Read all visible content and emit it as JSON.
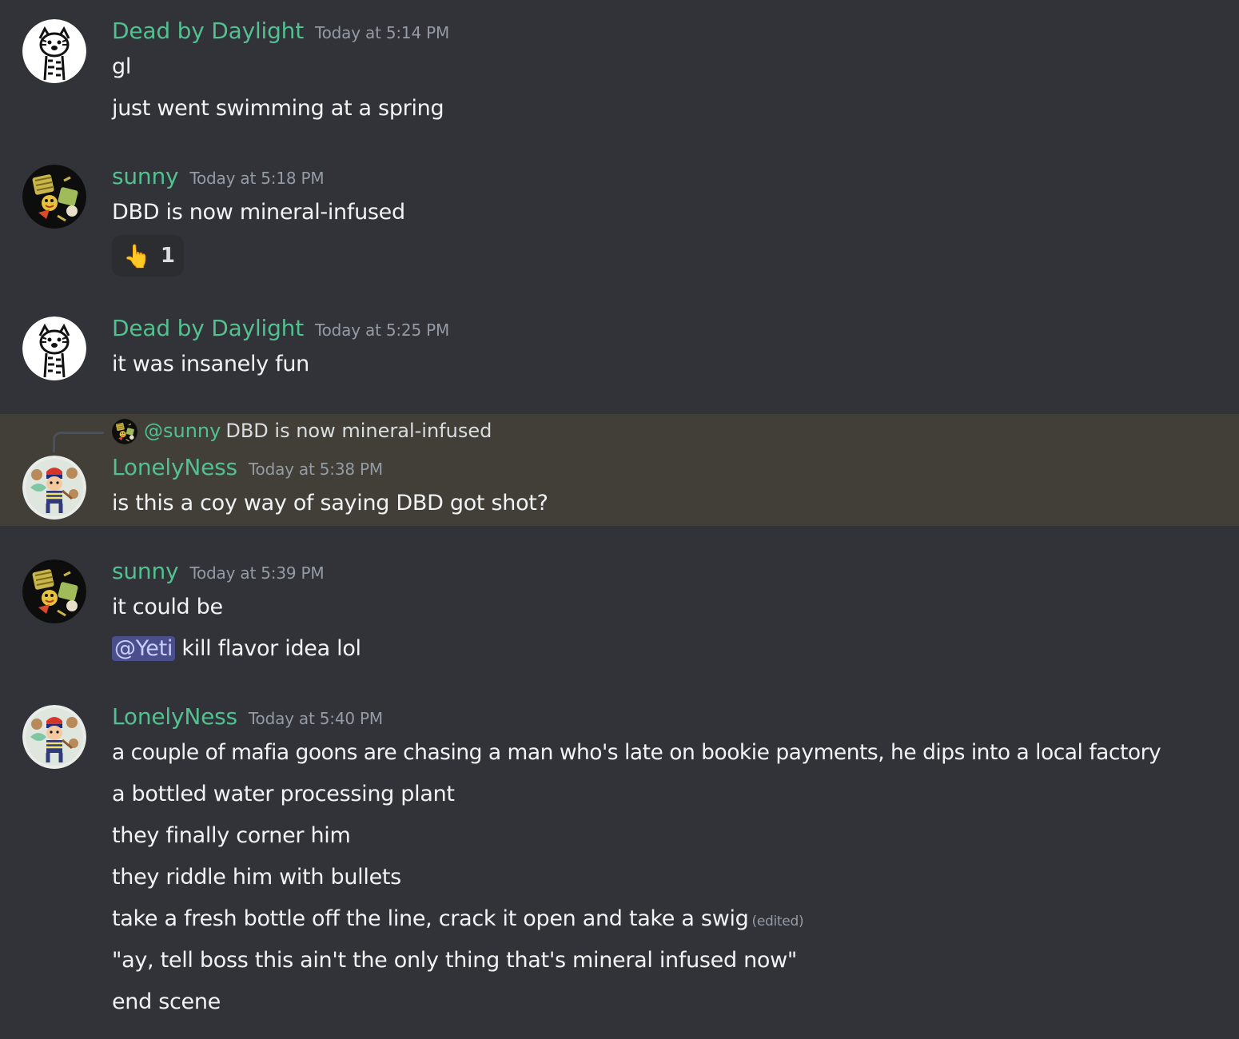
{
  "colors": {
    "background": "#313338",
    "username": "#52c08f",
    "timestamp": "#949ba4",
    "text": "#f2f3f5",
    "highlight": "#413f38",
    "mention_bg": "#4a4e8a"
  },
  "messages": [
    {
      "username": "Dead by Daylight",
      "timestamp": "Today at 5:14 PM",
      "avatar_icon": "cartoon-tiger-avatar",
      "lines": [
        "gl",
        "just went swimming at a spring"
      ]
    },
    {
      "username": "sunny",
      "timestamp": "Today at 5:18 PM",
      "avatar_icon": "yellow-cartoon-avatar",
      "lines": [
        "DBD is now mineral-infused"
      ],
      "reaction": {
        "emoji": "pointing-hand-icon",
        "glyph": "👆",
        "count": "1"
      }
    },
    {
      "username": "Dead by Daylight",
      "timestamp": "Today at 5:25 PM",
      "avatar_icon": "cartoon-tiger-avatar",
      "lines": [
        "it was insanely fun"
      ]
    },
    {
      "username": "LonelyNess",
      "timestamp": "Today at 5:38 PM",
      "avatar_icon": "pixel-hero-avatar",
      "reply_to": {
        "user": "@sunny",
        "text": "DBD is now mineral-infused"
      },
      "lines": [
        "is this a coy way of saying DBD got shot?"
      ]
    },
    {
      "username": "sunny",
      "timestamp": "Today at 5:39 PM",
      "avatar_icon": "yellow-cartoon-avatar",
      "lines": [
        "it could be",
        "kill flavor idea lol"
      ],
      "mention": "@Yeti"
    },
    {
      "username": "LonelyNess",
      "timestamp": "Today at 5:40 PM",
      "avatar_icon": "pixel-hero-avatar",
      "lines": [
        "a couple of mafia goons are chasing a man who's late on bookie payments, he dips into a local factory",
        "a bottled water processing plant",
        "they finally corner him",
        "they riddle him with bullets",
        "take a fresh bottle off the line, crack it open and take a swig",
        "\"ay, tell boss this ain't the only thing that's mineral infused now\"",
        "end scene"
      ],
      "edited_label": "(edited)"
    }
  ]
}
